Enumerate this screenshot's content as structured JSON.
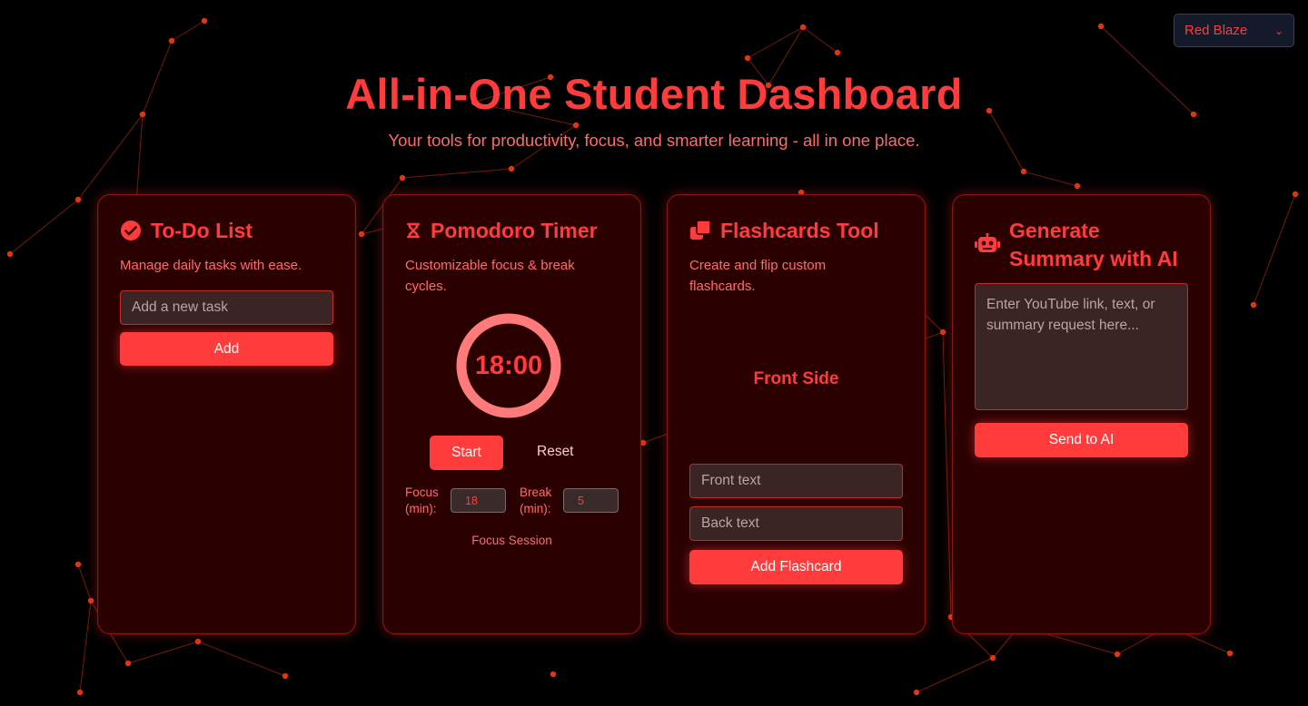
{
  "theme": {
    "selected": "Red Blaze",
    "accent": "#ff3b3b",
    "card_bg": "#2a0000"
  },
  "header": {
    "title": "All-in-One Student Dashboard",
    "subtitle": "Your tools for productivity, focus, and smarter learning - all in one place."
  },
  "todo": {
    "icon": "check-circle-icon",
    "title": "To-Do List",
    "description": "Manage daily tasks with ease.",
    "input_placeholder": "Add a new task",
    "add_label": "Add"
  },
  "pomodoro": {
    "icon": "hourglass-icon",
    "title": "Pomodoro Timer",
    "description": "Customizable focus & break cycles.",
    "time": "18:00",
    "start_label": "Start",
    "reset_label": "Reset",
    "focus_label": "Focus (min):",
    "focus_value": "18",
    "break_label": "Break (min):",
    "break_value": "5",
    "session_label": "Focus Session"
  },
  "flashcards": {
    "icon": "clone-icon",
    "title": "Flashcards Tool",
    "description": "Create and flip custom flashcards.",
    "card_face": "Front Side",
    "front_placeholder": "Front text",
    "back_placeholder": "Back text",
    "add_label": "Add Flashcard"
  },
  "summary": {
    "icon": "robot-icon",
    "title": "Generate Summary with AI",
    "textarea_placeholder": "Enter YouTube link, text, or summary request here...",
    "send_label": "Send to AI"
  }
}
